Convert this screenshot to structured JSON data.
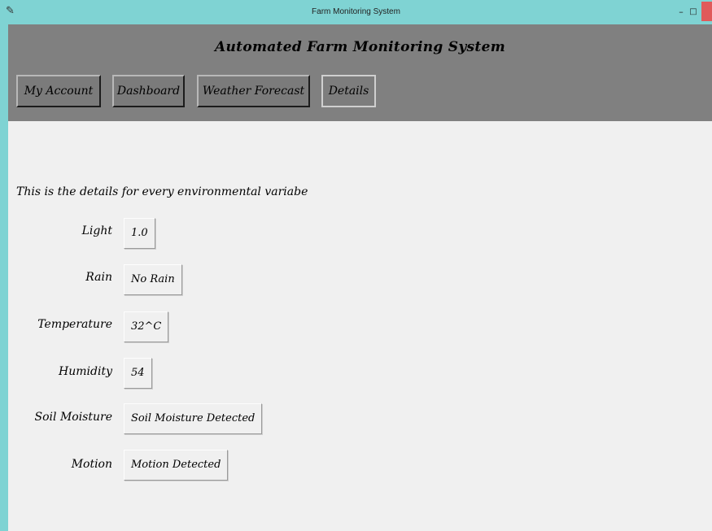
{
  "window": {
    "title": "Farm Monitoring System",
    "icon": "feather-icon",
    "controls": {
      "minimize": "–",
      "maximize": "□"
    }
  },
  "header": {
    "app_title": "Automated Farm Monitoring System",
    "nav": [
      {
        "label": "My Account"
      },
      {
        "label": "Dashboard"
      },
      {
        "label": "Weather Forecast"
      },
      {
        "label": "Details",
        "active": true
      }
    ]
  },
  "details": {
    "intro": "This is the details for every environmental variabe",
    "variables": [
      {
        "label": "Light",
        "value": "1.0"
      },
      {
        "label": "Rain",
        "value": "No Rain"
      },
      {
        "label": "Temperature",
        "value": "32^C"
      },
      {
        "label": "Humidity",
        "value": "54"
      },
      {
        "label": "Soil Moisture",
        "value": "Soil Moisture Detected"
      },
      {
        "label": "Motion",
        "value": "Motion Detected"
      }
    ]
  },
  "colors": {
    "titlebar": "#7fd3d3",
    "header": "#808080",
    "content": "#f0f0f0",
    "close": "#e05a5a"
  }
}
